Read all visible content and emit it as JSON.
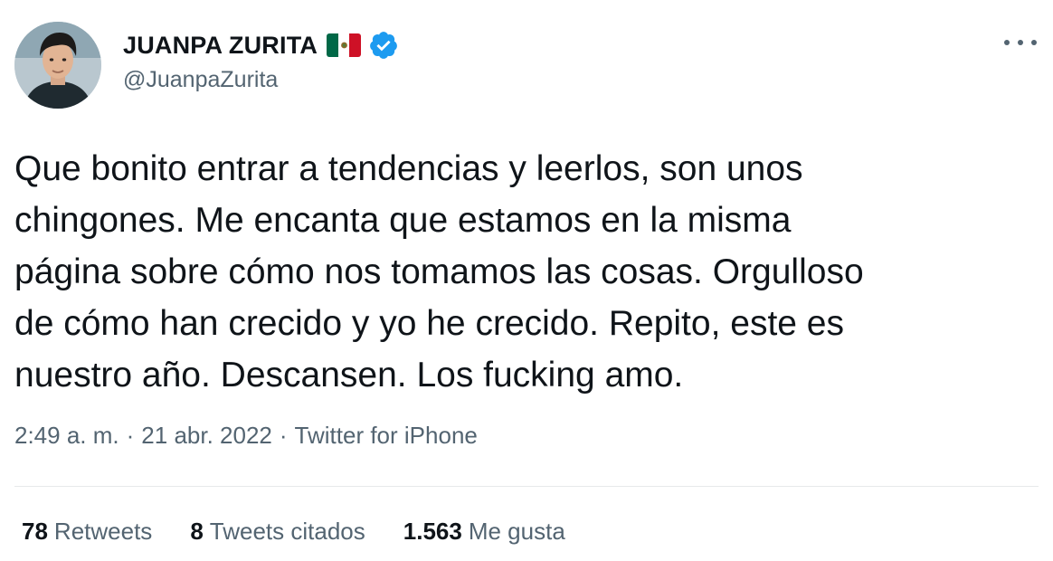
{
  "user": {
    "display_name": "JUANPA ZURITA",
    "handle": "@JuanpaZurita",
    "flag_icon": "mexico-flag-icon",
    "verified_icon": "verified-badge-icon",
    "verified_color": "#1d9bf0"
  },
  "menu": {
    "icon": "more-options-icon"
  },
  "tweet": {
    "lines": [
      "Que bonito entrar a tendencias y leerlos, son unos",
      "chingones. Me encanta que estamos en la misma",
      "página sobre cómo nos tomamos las cosas. Orgulloso",
      "de cómo han crecido y yo he crecido. Repito, este es",
      "nuestro año. Descansen. Los fucking amo."
    ]
  },
  "meta": {
    "time": "2:49 a. m.",
    "separator": "·",
    "date": "21 abr. 2022",
    "source": "Twitter for iPhone"
  },
  "stats": {
    "retweets_count": "78",
    "retweets_label": "Retweets",
    "quotes_count": "8",
    "quotes_label": "Tweets citados",
    "likes_count": "1.563",
    "likes_label": "Me gusta"
  },
  "colors": {
    "text_primary": "#0f1419",
    "text_secondary": "#536471",
    "divider": "#e7e9ea",
    "flag_green": "#006847",
    "flag_white": "#ffffff",
    "flag_red": "#ce1126"
  }
}
